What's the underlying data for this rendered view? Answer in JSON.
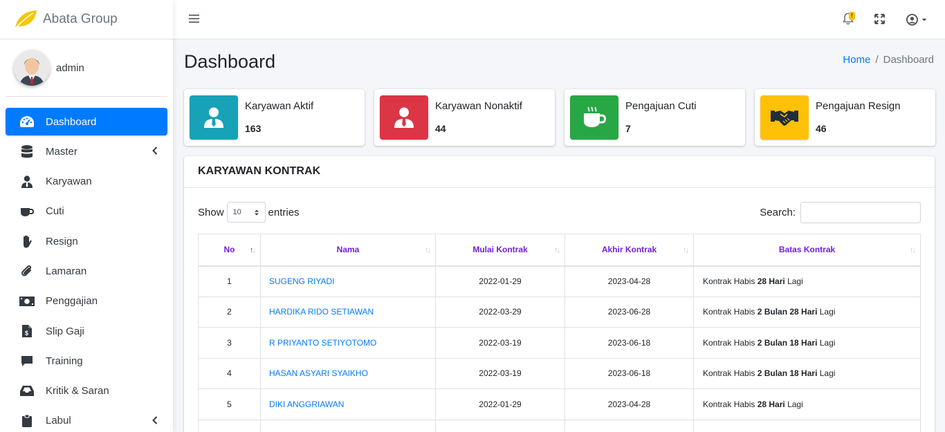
{
  "brand": {
    "name": "Abata Group"
  },
  "user": {
    "name": "admin"
  },
  "sidebar": {
    "items": [
      {
        "label": "Dashboard",
        "icon": "tachometer-icon",
        "active": true,
        "has_arrow": false
      },
      {
        "label": "Master",
        "icon": "database-icon",
        "active": false,
        "has_arrow": true
      },
      {
        "label": "Karyawan",
        "icon": "user-tie-icon",
        "active": false,
        "has_arrow": false
      },
      {
        "label": "Cuti",
        "icon": "coffee-icon",
        "active": false,
        "has_arrow": false
      },
      {
        "label": "Resign",
        "icon": "hand-icon",
        "active": false,
        "has_arrow": false
      },
      {
        "label": "Lamaran",
        "icon": "paperclip-icon",
        "active": false,
        "has_arrow": false
      },
      {
        "label": "Penggajian",
        "icon": "money-bill-icon",
        "active": false,
        "has_arrow": false
      },
      {
        "label": "Slip Gaji",
        "icon": "file-invoice-dollar-icon",
        "active": false,
        "has_arrow": false
      },
      {
        "label": "Training",
        "icon": "comment-icon",
        "active": false,
        "has_arrow": false
      },
      {
        "label": "Kritik & Saran",
        "icon": "inbox-icon",
        "active": false,
        "has_arrow": false
      },
      {
        "label": "Labul",
        "icon": "clipboard-icon",
        "active": false,
        "has_arrow": true
      }
    ]
  },
  "navbar": {
    "notification_badge": "!"
  },
  "header": {
    "title": "Dashboard",
    "breadcrumb": {
      "home": "Home",
      "current": "Dashboard"
    }
  },
  "info_boxes": [
    {
      "label": "Karyawan Aktif",
      "value": "163",
      "color": "#17a2b8",
      "icon": "user-tie-icon"
    },
    {
      "label": "Karyawan Nonaktif",
      "value": "44",
      "color": "#dc3545",
      "icon": "user-tie-icon"
    },
    {
      "label": "Pengajuan Cuti",
      "value": "7",
      "color": "#28a745",
      "icon": "coffee-icon"
    },
    {
      "label": "Pengajuan Resign",
      "value": "46",
      "color": "#ffc107",
      "icon": "handshake-icon"
    }
  ],
  "card": {
    "title": "KARYAWAN KONTRAK",
    "length": {
      "show_label": "Show",
      "value": "10",
      "entries_label": "entries"
    },
    "search_label": "Search:",
    "columns": [
      "No",
      "Nama",
      "Mulai Kontrak",
      "Akhir Kontrak",
      "Batas Kontrak"
    ],
    "rows": [
      {
        "no": "1",
        "nama": "SUGENG RIYADI",
        "mulai": "2022-01-29",
        "akhir": "2023-04-28",
        "batas_pre": "Kontrak Habis ",
        "batas_bold": "28 Hari",
        "batas_post": " Lagi"
      },
      {
        "no": "2",
        "nama": "HARDIKA RIDO SETIAWAN",
        "mulai": "2022-03-29",
        "akhir": "2023-06-28",
        "batas_pre": "Kontrak Habis ",
        "batas_bold": "2 Bulan 28 Hari",
        "batas_post": " Lagi"
      },
      {
        "no": "3",
        "nama": "R PRIYANTO SETIYOTOMO",
        "mulai": "2022-03-19",
        "akhir": "2023-06-18",
        "batas_pre": "Kontrak Habis ",
        "batas_bold": "2 Bulan 18 Hari",
        "batas_post": " Lagi"
      },
      {
        "no": "4",
        "nama": "HASAN ASYARI SYAIKHO",
        "mulai": "2022-03-19",
        "akhir": "2023-06-18",
        "batas_pre": "Kontrak Habis ",
        "batas_bold": "2 Bulan 18 Hari",
        "batas_post": " Lagi"
      },
      {
        "no": "5",
        "nama": "DIKI ANGGRIAWAN",
        "mulai": "2022-01-29",
        "akhir": "2023-04-28",
        "batas_pre": "Kontrak Habis ",
        "batas_bold": "28 Hari",
        "batas_post": " Lagi"
      }
    ]
  }
}
